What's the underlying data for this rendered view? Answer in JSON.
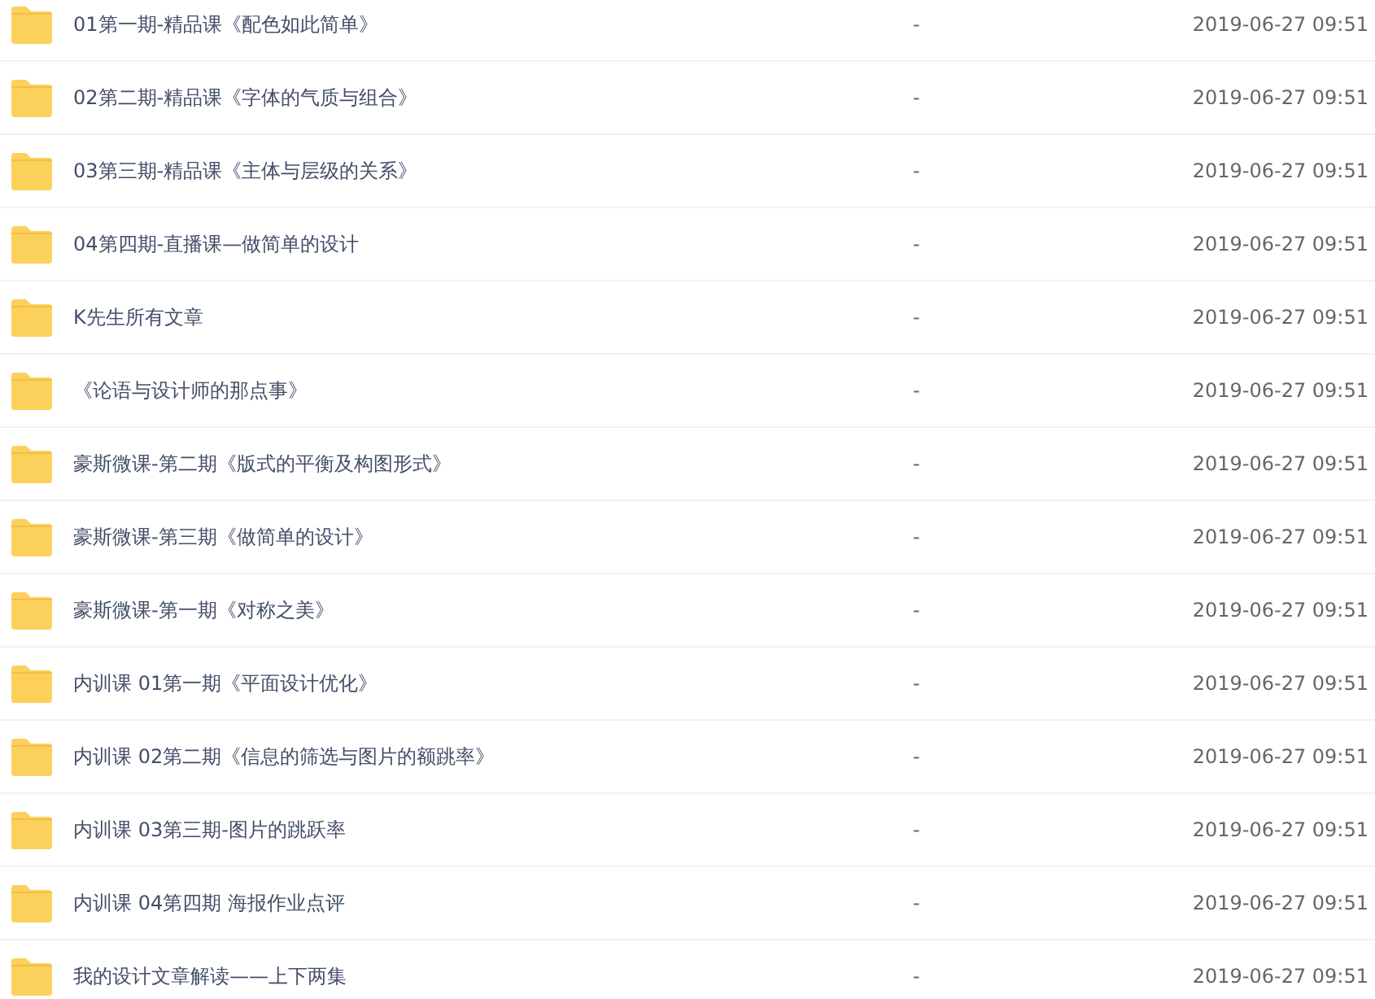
{
  "files": [
    {
      "name": "01第一期-精品课《配色如此简单》",
      "size": "-",
      "modified": "2019-06-27 09:51"
    },
    {
      "name": "02第二期-精品课《字体的气质与组合》",
      "size": "-",
      "modified": "2019-06-27 09:51"
    },
    {
      "name": "03第三期-精品课《主体与层级的关系》",
      "size": "-",
      "modified": "2019-06-27 09:51"
    },
    {
      "name": "04第四期-直播课—做简单的设计",
      "size": "-",
      "modified": "2019-06-27 09:51"
    },
    {
      "name": "K先生所有文章",
      "size": "-",
      "modified": "2019-06-27 09:51"
    },
    {
      "name": "《论语与设计师的那点事》",
      "size": "-",
      "modified": "2019-06-27 09:51"
    },
    {
      "name": "豪斯微课-第二期《版式的平衡及构图形式》",
      "size": "-",
      "modified": "2019-06-27 09:51"
    },
    {
      "name": "豪斯微课-第三期《做简单的设计》",
      "size": "-",
      "modified": "2019-06-27 09:51"
    },
    {
      "name": "豪斯微课-第一期《对称之美》",
      "size": "-",
      "modified": "2019-06-27 09:51"
    },
    {
      "name": "内训课 01第一期《平面设计优化》",
      "size": "-",
      "modified": "2019-06-27 09:51"
    },
    {
      "name": "内训课 02第二期《信息的筛选与图片的额跳率》",
      "size": "-",
      "modified": "2019-06-27 09:51"
    },
    {
      "name": "内训课 03第三期-图片的跳跃率",
      "size": "-",
      "modified": "2019-06-27 09:51"
    },
    {
      "name": "内训课 04第四期 海报作业点评",
      "size": "-",
      "modified": "2019-06-27 09:51"
    },
    {
      "name": "我的设计文章解读——上下两集",
      "size": "-",
      "modified": "2019-06-27 09:51"
    }
  ]
}
